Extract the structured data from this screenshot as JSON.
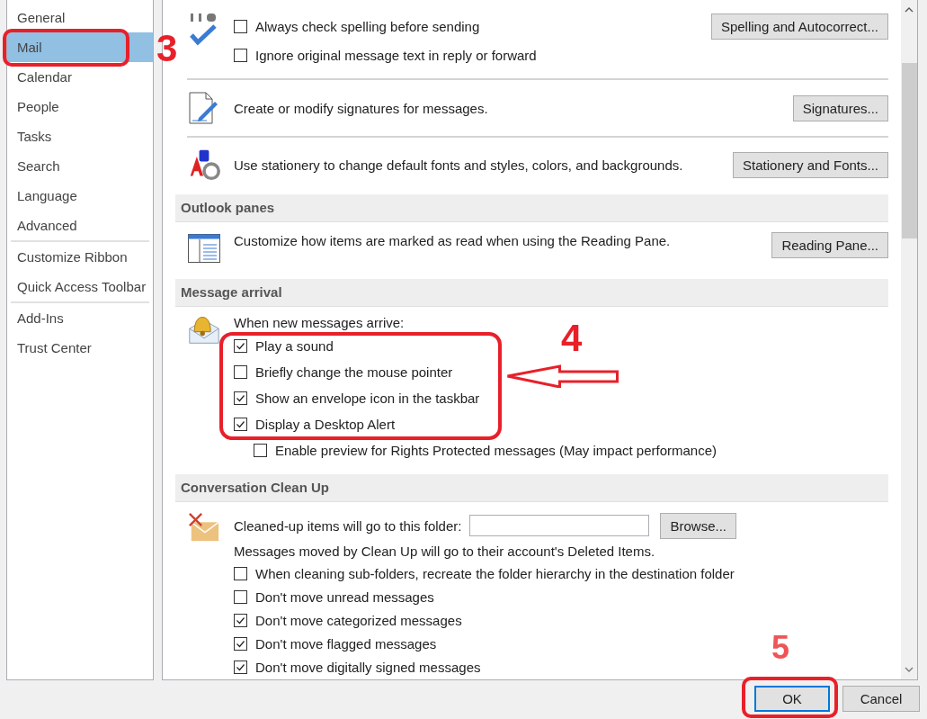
{
  "sidebar": {
    "groups": [
      {
        "items": [
          {
            "label": "General",
            "selected": false
          },
          {
            "label": "Mail",
            "selected": true
          },
          {
            "label": "Calendar",
            "selected": false
          },
          {
            "label": "People",
            "selected": false
          },
          {
            "label": "Tasks",
            "selected": false
          },
          {
            "label": "Search",
            "selected": false
          },
          {
            "label": "Language",
            "selected": false
          },
          {
            "label": "Advanced",
            "selected": false
          }
        ]
      },
      {
        "items": [
          {
            "label": "Customize Ribbon",
            "selected": false
          },
          {
            "label": "Quick Access Toolbar",
            "selected": false
          }
        ]
      },
      {
        "items": [
          {
            "label": "Add-Ins",
            "selected": false
          },
          {
            "label": "Trust Center",
            "selected": false
          }
        ]
      }
    ]
  },
  "compose": {
    "spelling": {
      "options": [
        {
          "label": "Always check spelling before sending",
          "checked": false
        },
        {
          "label": "Ignore original message text in reply or forward",
          "checked": false
        }
      ],
      "button": "Spelling and Autocorrect..."
    },
    "signatures": {
      "text": "Create or modify signatures for messages.",
      "button": "Signatures..."
    },
    "stationery": {
      "text": "Use stationery to change default fonts and styles, colors, and backgrounds.",
      "button": "Stationery and Fonts..."
    }
  },
  "outlook_panes": {
    "title": "Outlook panes",
    "text": "Customize how items are marked as read when using the Reading Pane.",
    "button": "Reading Pane..."
  },
  "message_arrival": {
    "title": "Message arrival",
    "intro": "When new messages arrive:",
    "options": [
      {
        "label": "Play a sound",
        "checked": true
      },
      {
        "label": "Briefly change the mouse pointer",
        "checked": false
      },
      {
        "label": "Show an envelope icon in the taskbar",
        "checked": true
      },
      {
        "label": "Display a Desktop Alert",
        "checked": true
      }
    ],
    "sub_option": {
      "label": "Enable preview for Rights Protected messages (May impact performance)",
      "checked": false
    }
  },
  "conversation_clean_up": {
    "title": "Conversation Clean Up",
    "folder_label": "Cleaned-up items will go to this folder:",
    "button": "Browse...",
    "note": "Messages moved by Clean Up will go to their account's Deleted Items.",
    "options": [
      {
        "label": "When cleaning sub-folders, recreate the folder hierarchy in the destination folder",
        "checked": false
      },
      {
        "label": "Don't move unread messages",
        "checked": false
      },
      {
        "label": "Don't move categorized messages",
        "checked": true
      },
      {
        "label": "Don't move flagged messages",
        "checked": true
      },
      {
        "label": "Don't move digitally signed messages",
        "checked": true
      }
    ]
  },
  "buttons": [
    {
      "label": "OK",
      "default": true
    },
    {
      "label": "Cancel",
      "default": false
    }
  ],
  "annotations": [
    {
      "label": "3"
    },
    {
      "label": "4"
    },
    {
      "label": "5"
    }
  ]
}
